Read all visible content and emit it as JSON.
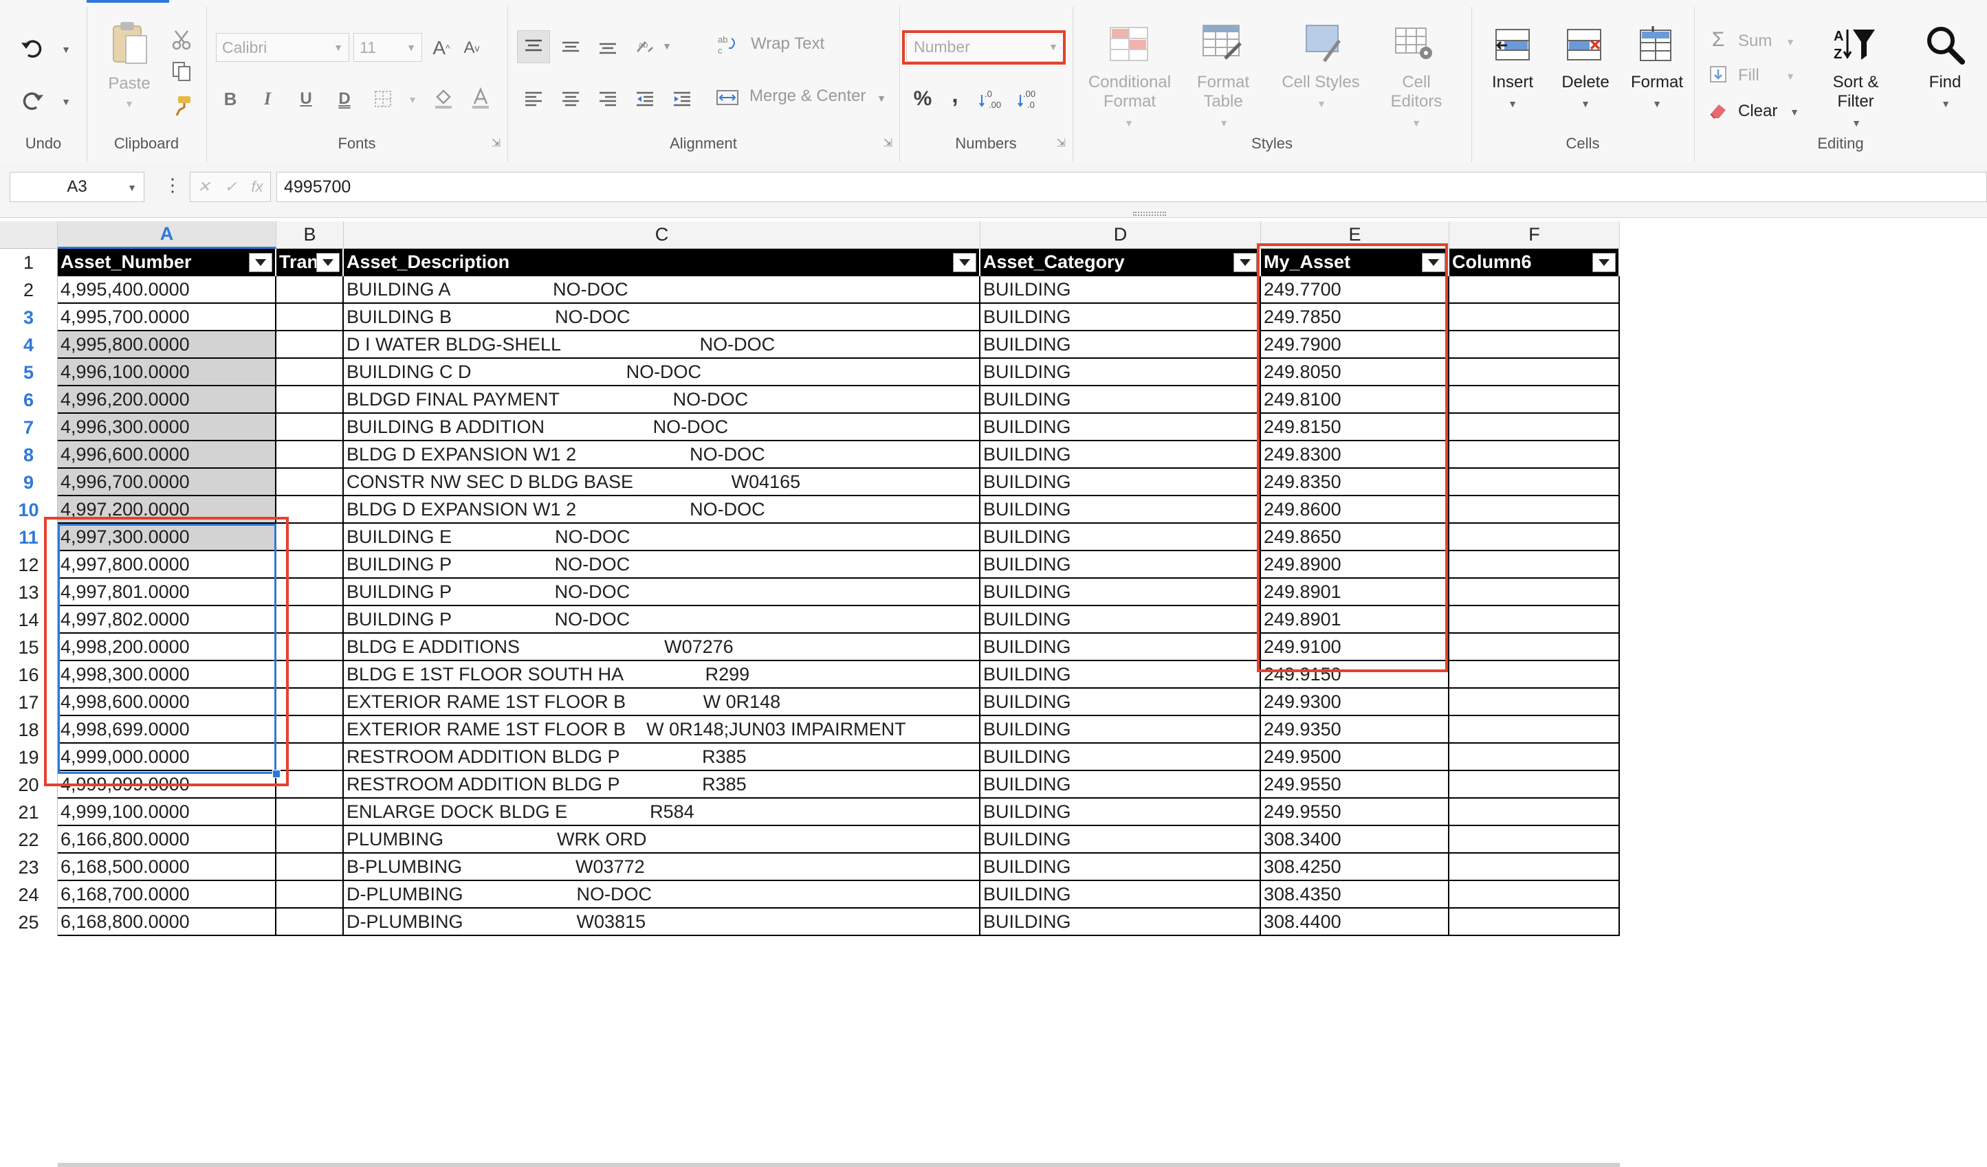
{
  "ribbon": {
    "undo": {
      "label": "Undo"
    },
    "clipboard": {
      "paste_label": "Paste",
      "group_label": "Clipboard"
    },
    "fonts": {
      "font_name": "Calibri",
      "font_size": "11",
      "group_label": "Fonts",
      "grow_label": "A",
      "shrink_label": "A",
      "bold": "B",
      "italic": "I",
      "underline": "U",
      "double_underline": "D"
    },
    "alignment": {
      "wrap_text": "Wrap Text",
      "merge_center": "Merge & Center",
      "group_label": "Alignment"
    },
    "numbers": {
      "format_value": "Number",
      "percent": "%",
      "comma": ",",
      "inc_decimal": ".0→.00",
      "dec_decimal": ".00→.0",
      "group_label": "Numbers"
    },
    "styles": {
      "conditional_format": "Conditional Format",
      "format_table": "Format Table",
      "cell_styles": "Cell Styles",
      "cell_editors": "Cell Editors",
      "group_label": "Styles"
    },
    "cells": {
      "insert": "Insert",
      "delete": "Delete",
      "format": "Format",
      "group_label": "Cells"
    },
    "editing": {
      "sum": "Sum",
      "fill": "Fill",
      "clear": "Clear",
      "sort_filter": "Sort & Filter",
      "find": "Find",
      "group_label": "Editing"
    }
  },
  "formula_bar": {
    "name_box": "A3",
    "cancel": "✕",
    "confirm": "✓",
    "fx": "fx",
    "value": "4995700"
  },
  "columns": [
    "A",
    "B",
    "C",
    "D",
    "E",
    "F"
  ],
  "header_row": {
    "row_num": "1",
    "cells": [
      "Asset_Number",
      "Tran",
      "Asset_Description",
      "Asset_Category",
      "My_Asset",
      "Column6"
    ]
  },
  "rows": [
    {
      "num": "2",
      "a": "4,995,400.0000",
      "c": "BUILDING A                    NO-DOC",
      "d": "BUILDING",
      "e": "249.7700"
    },
    {
      "num": "3",
      "a": "4,995,700.0000",
      "c": "BUILDING B                    NO-DOC",
      "d": "BUILDING",
      "e": "249.7850"
    },
    {
      "num": "4",
      "a": "4,995,800.0000",
      "c": "D I WATER BLDG-SHELL                           NO-DOC",
      "d": "BUILDING",
      "e": "249.7900"
    },
    {
      "num": "5",
      "a": "4,996,100.0000",
      "c": "BUILDING C D                              NO-DOC",
      "d": "BUILDING",
      "e": "249.8050"
    },
    {
      "num": "6",
      "a": "4,996,200.0000",
      "c": "BLDGD FINAL PAYMENT                      NO-DOC",
      "d": "BUILDING",
      "e": "249.8100"
    },
    {
      "num": "7",
      "a": "4,996,300.0000",
      "c": "BUILDING B ADDITION                     NO-DOC",
      "d": "BUILDING",
      "e": "249.8150"
    },
    {
      "num": "8",
      "a": "4,996,600.0000",
      "c": "BLDG D EXPANSION W1 2                      NO-DOC",
      "d": "BUILDING",
      "e": "249.8300"
    },
    {
      "num": "9",
      "a": "4,996,700.0000",
      "c": "CONSTR NW SEC D BLDG BASE                   W04165",
      "d": "BUILDING",
      "e": "249.8350"
    },
    {
      "num": "10",
      "a": "4,997,200.0000",
      "c": "BLDG D EXPANSION W1 2                      NO-DOC",
      "d": "BUILDING",
      "e": "249.8600"
    },
    {
      "num": "11",
      "a": "4,997,300.0000",
      "c": "BUILDING E                    NO-DOC",
      "d": "BUILDING",
      "e": "249.8650"
    },
    {
      "num": "12",
      "a": "4,997,800.0000",
      "c": "BUILDING P                    NO-DOC",
      "d": "BUILDING",
      "e": "249.8900"
    },
    {
      "num": "13",
      "a": "4,997,801.0000",
      "c": "BUILDING P                    NO-DOC",
      "d": "BUILDING",
      "e": "249.8901"
    },
    {
      "num": "14",
      "a": "4,997,802.0000",
      "c": "BUILDING P                    NO-DOC",
      "d": "BUILDING",
      "e": "249.8901"
    },
    {
      "num": "15",
      "a": "4,998,200.0000",
      "c": "BLDG E ADDITIONS                            W07276",
      "d": "BUILDING",
      "e": "249.9100"
    },
    {
      "num": "16",
      "a": "4,998,300.0000",
      "c": "BLDG E 1ST FLOOR SOUTH HA                R299",
      "d": "BUILDING",
      "e": "249.9150"
    },
    {
      "num": "17",
      "a": "4,998,600.0000",
      "c": "EXTERIOR RAME 1ST FLOOR B               W 0R148",
      "d": "BUILDING",
      "e": "249.9300"
    },
    {
      "num": "18",
      "a": "4,998,699.0000",
      "c": "EXTERIOR RAME 1ST FLOOR B    W 0R148;JUN03 IMPAIRMENT",
      "d": "BUILDING",
      "e": "249.9350"
    },
    {
      "num": "19",
      "a": "4,999,000.0000",
      "c": "RESTROOM ADDITION BLDG P                R385",
      "d": "BUILDING",
      "e": "249.9500"
    },
    {
      "num": "20",
      "a": "4,999,099.0000",
      "c": "RESTROOM ADDITION BLDG P                R385",
      "d": "BUILDING",
      "e": "249.9550"
    },
    {
      "num": "21",
      "a": "4,999,100.0000",
      "c": "ENLARGE DOCK BLDG E                R584",
      "d": "BUILDING",
      "e": "249.9550"
    },
    {
      "num": "22",
      "a": "6,166,800.0000",
      "c": "PLUMBING                      WRK ORD",
      "d": "BUILDING",
      "e": "308.3400"
    },
    {
      "num": "23",
      "a": "6,168,500.0000",
      "c": "B-PLUMBING                      W03772",
      "d": "BUILDING",
      "e": "308.4250"
    },
    {
      "num": "24",
      "a": "6,168,700.0000",
      "c": "D-PLUMBING                      NO-DOC",
      "d": "BUILDING",
      "e": "308.4350"
    },
    {
      "num": "25",
      "a": "6,168,800.0000",
      "c": "D-PLUMBING                      W03815",
      "d": "BUILDING",
      "e": "308.4400"
    }
  ],
  "colors": {
    "accent": "#2f78d8",
    "annotation": "#e5412c",
    "header_bg": "#000000",
    "selection_fill": "#d3d3d3"
  },
  "icons": [
    "undo-icon",
    "redo-icon",
    "paste-icon",
    "cut-icon",
    "copy-icon",
    "format-painter-icon",
    "sum-icon",
    "fill-icon",
    "clear-icon",
    "sort-filter-icon",
    "find-icon"
  ]
}
